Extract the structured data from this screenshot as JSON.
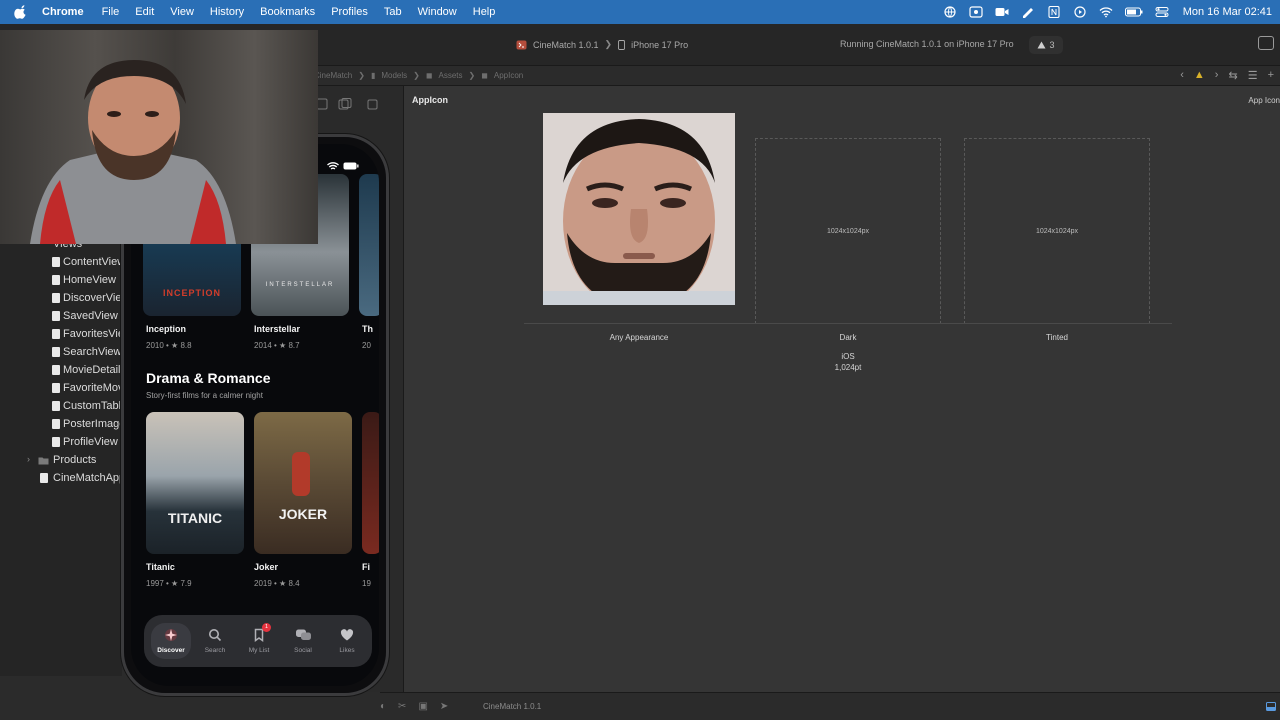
{
  "menubar": {
    "app": "Chrome",
    "items": [
      "File",
      "Edit",
      "View",
      "History",
      "Bookmarks",
      "Profiles",
      "Tab",
      "Window",
      "Help"
    ],
    "clock": "Mon 16 Mar  02:41"
  },
  "toolbar": {
    "scheme": "CineMatch 1.0.1",
    "destination": "iPhone 17 Pro",
    "status": "Running CineMatch 1.0.1 on iPhone 17 Pro",
    "warnings": "3"
  },
  "jumpbar": {
    "crumbs": [
      "CineMatch",
      "Models",
      "Assets",
      "AppIcon"
    ]
  },
  "navigator": {
    "group": "Views",
    "files": [
      "ContentView",
      "HomeView",
      "DiscoverView",
      "SavedView",
      "FavoritesView",
      "SearchView",
      "MovieDetail",
      "FavoriteMov",
      "CustomTabl",
      "PosterImage",
      "ProfileView"
    ],
    "products": "Products",
    "app_file": "CineMatchApp"
  },
  "editor": {
    "title": "AppIcon",
    "right_label": "App Icon",
    "slots": [
      {
        "caption": "Any Appearance",
        "size": ""
      },
      {
        "caption": "Dark",
        "size": "1024x1024px"
      },
      {
        "caption": "Tinted",
        "size": "1024x1024px"
      }
    ],
    "platform": "iOS",
    "platform_size": "1,024pt"
  },
  "debugbar": {
    "label": "CineMatch 1.0.1"
  },
  "phone": {
    "row1": [
      {
        "title": "Inception",
        "meta": "2010 • ★ 8.8",
        "poster_text": "INCEPTION"
      },
      {
        "title": "Interstellar",
        "meta": "2014 • ★ 8.7",
        "poster_text": "INTERSTELLAR"
      },
      {
        "title": "Th",
        "meta": "20"
      }
    ],
    "section": {
      "title": "Drama & Romance",
      "subtitle": "Story-first films for a calmer night"
    },
    "row2": [
      {
        "title": "Titanic",
        "meta": "1997 • ★ 7.9",
        "poster_text": "TITANIC"
      },
      {
        "title": "Joker",
        "meta": "2019 • ★ 8.4",
        "poster_text": "JOKER"
      },
      {
        "title": "Fi",
        "meta": "19"
      }
    ],
    "tabs": [
      {
        "label": "Discover",
        "icon": "sparkle-icon",
        "active": true
      },
      {
        "label": "Search",
        "icon": "search-icon"
      },
      {
        "label": "My List",
        "icon": "bookmark-icon",
        "badge": "1"
      },
      {
        "label": "Social",
        "icon": "chat-bubbles-icon"
      },
      {
        "label": "Likes",
        "icon": "heart-icon"
      }
    ]
  },
  "colors": {
    "menubar": "#2a6fb6",
    "accent_red": "#e5333f",
    "editor_bg": "#353535"
  }
}
